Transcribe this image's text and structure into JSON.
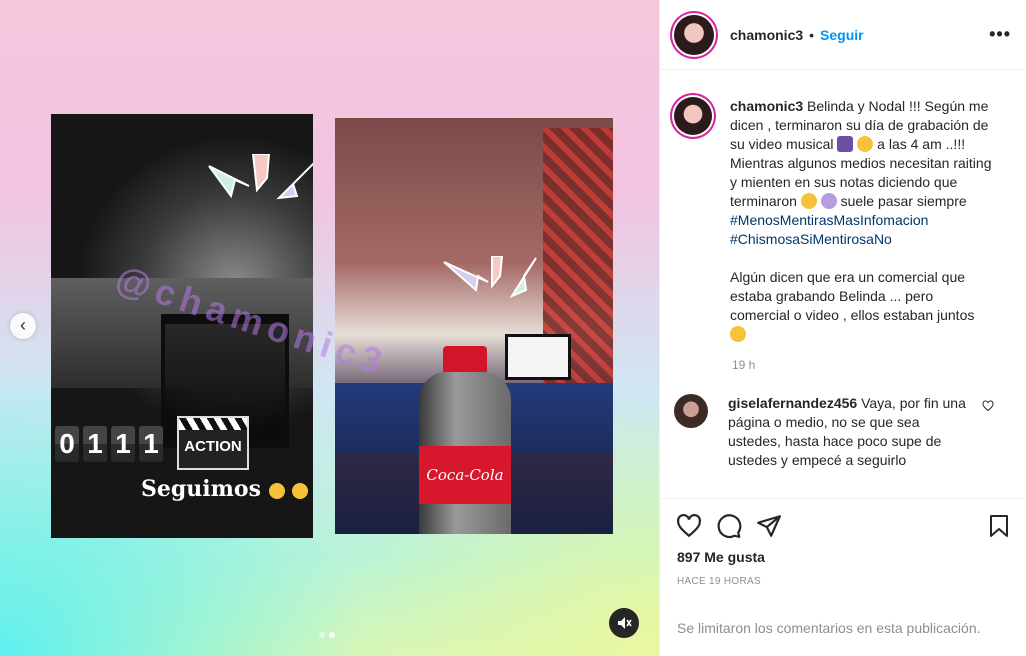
{
  "post": {
    "username": "chamonic3",
    "follow_label": "Seguir",
    "separator": "•",
    "more_icon": "more-icon",
    "caption_lines": [
      "Belinda y Nodal !!! Según me dicen , terminaron su día de grabación de su video musical",
      "a las 4 am ..!!! Mientras algunos medios necesitan raiting y mienten en sus notas diciendo que terminaron",
      "suele pasar siempre"
    ],
    "hashtags": [
      "#MenosMentirasMasInfomacion",
      "#ChismosaSiMentirosaNo"
    ],
    "caption_para2": "Algún dicen que era un comercial que estaba grabando Belinda ... pero comercial o video , ellos estaban juntos",
    "caption_time": "19 h",
    "likes": "897 Me gusta",
    "posted_ago": "HACE 19 HORAS",
    "comments_limited": "Se limitaron los comentarios en esta publicación."
  },
  "comment": {
    "username": "giselafernandez456",
    "text": "Vaya, por fin una página o medio, no se que sea ustedes, hasta hace poco supe de ustedes y empecé a seguirlo"
  },
  "media": {
    "counter_digits": [
      "0",
      "1",
      "1",
      "1"
    ],
    "clapboard_text": "ACTION",
    "story_text": "Seguimos",
    "watermark": "@chamonic3",
    "bottle_label": "Coca-Cola",
    "dots": 2,
    "active_dot": 1
  },
  "colors": {
    "link": "#0095f6",
    "hashtag": "#00376b",
    "muted": "#8e8e8e",
    "text": "#262626"
  }
}
